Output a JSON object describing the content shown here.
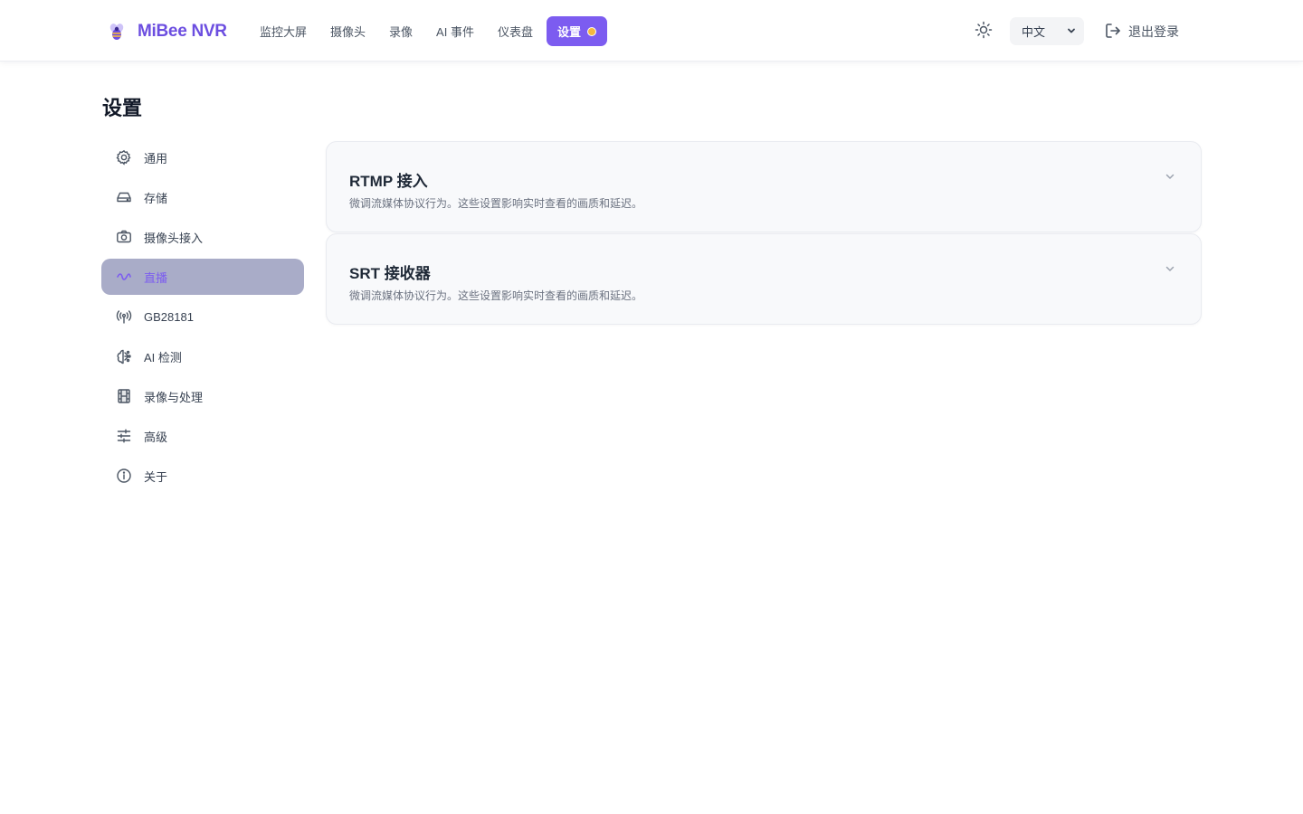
{
  "app": {
    "name": "MiBee NVR",
    "accent": "#7c5cf0",
    "badge_color": "#f5b83d"
  },
  "nav": {
    "items": [
      {
        "label": "监控大屏"
      },
      {
        "label": "摄像头"
      },
      {
        "label": "录像"
      },
      {
        "label": "AI 事件"
      },
      {
        "label": "仪表盘"
      },
      {
        "label": "设置",
        "active": true
      }
    ]
  },
  "header": {
    "language": "中文",
    "logout_label": "退出登录"
  },
  "page": {
    "title": "设置"
  },
  "sidebar": {
    "items": [
      {
        "label": "通用",
        "icon": "gear-icon"
      },
      {
        "label": "存储",
        "icon": "hard-drive-icon"
      },
      {
        "label": "摄像头接入",
        "icon": "camera-icon"
      },
      {
        "label": "直播",
        "icon": "stream-icon",
        "active": true
      },
      {
        "label": "GB28181",
        "icon": "radio-tower-icon"
      },
      {
        "label": "AI 检测",
        "icon": "ai-brain-icon"
      },
      {
        "label": "录像与处理",
        "icon": "film-icon"
      },
      {
        "label": "高级",
        "icon": "sliders-icon"
      },
      {
        "label": "关于",
        "icon": "info-icon"
      }
    ]
  },
  "panels": [
    {
      "title": "RTMP 接入",
      "description": "微调流媒体协议行为。这些设置影响实时查看的画质和延迟。"
    },
    {
      "title": "SRT 接收器",
      "description": "微调流媒体协议行为。这些设置影响实时查看的画质和延迟。"
    }
  ]
}
